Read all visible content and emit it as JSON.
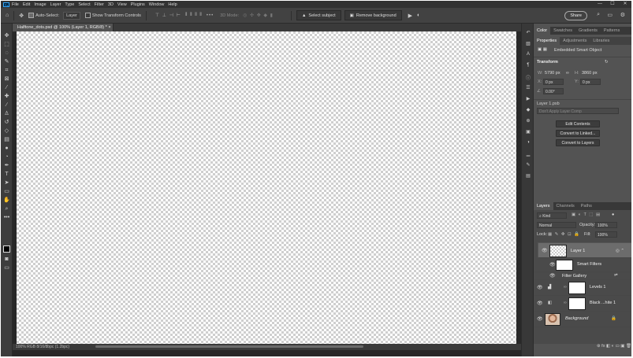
{
  "app": {
    "logo": "Ps"
  },
  "menu": [
    "File",
    "Edit",
    "Image",
    "Layer",
    "Type",
    "Select",
    "Filter",
    "3D",
    "View",
    "Plugins",
    "Window",
    "Help"
  ],
  "window_controls": [
    "—",
    "☐",
    "✕"
  ],
  "options": {
    "auto_select_label": "Auto-Select:",
    "layer_select": "Layer",
    "show_transform_label": "Show Transform Controls",
    "mode_3d": "3D Mode:",
    "select_subject": "Select subject",
    "remove_background": "Remove background",
    "share": "Share"
  },
  "document_tab": "Halftone_dots.psd @ 100% (Layer 1, RGB/8) * ×",
  "status": "100%    RGB 8/16/8bpc (1.2bpc)",
  "top_panel": {
    "tabs": [
      "Color",
      "Swatches",
      "Gradients",
      "Patterns"
    ],
    "subtabs": [
      "Properties",
      "Adjustments",
      "Libraries"
    ],
    "object_type": "Embedded Smart Object",
    "transform_title": "Transform",
    "w_label": "W:",
    "w_value": "5790 px",
    "h_label": "H:",
    "h_value": "3860 px",
    "x_label": "X:",
    "x_value": "0 px",
    "y_label": "Y:",
    "y_value": "0 px",
    "angle_value": "0.00°",
    "file_name": "Layer 1.psb",
    "layer_comp": "Don't Apply Layer Comp",
    "buttons": [
      "Edit Contents",
      "Convert to Linked...",
      "Convert to Layers"
    ]
  },
  "layers_panel": {
    "tabs": [
      "Layers",
      "Channels",
      "Paths"
    ],
    "kind": "Kind",
    "blend_mode": "Normal",
    "opacity_label": "Opacity:",
    "opacity_value": "100%",
    "lock_label": "Lock:",
    "fill_label": "Fill:",
    "fill_value": "100%",
    "layers": [
      {
        "name": "Layer 1"
      },
      {
        "name": "Smart Filters"
      },
      {
        "name": "Filter Gallery"
      },
      {
        "name": "Levels 1"
      },
      {
        "name": "Black ...hite 1"
      },
      {
        "name": "Background"
      }
    ],
    "footer": "⊛ fx ◧ ◐ ▭ ▣ 🗑"
  }
}
